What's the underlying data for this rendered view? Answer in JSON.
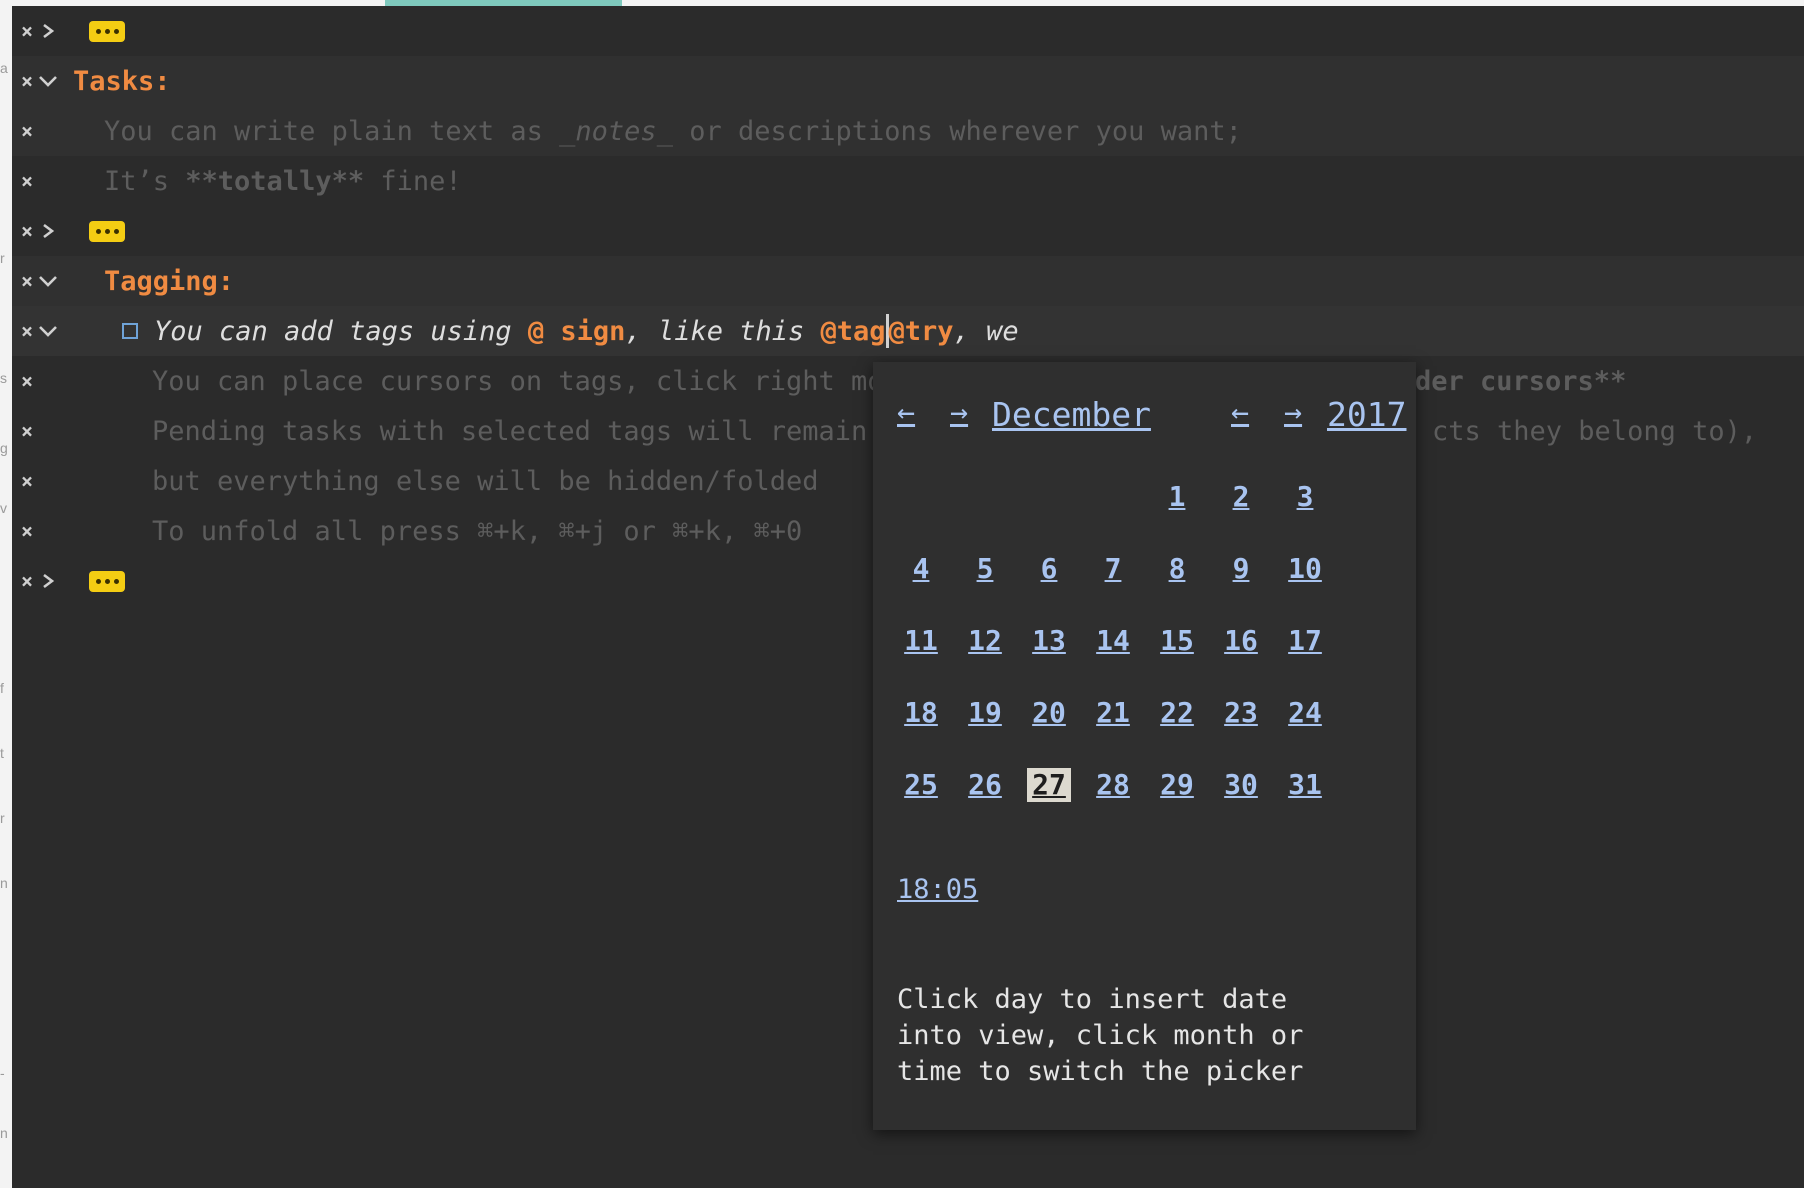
{
  "editor": {
    "folded_placeholder": "…",
    "tasks_project": "Tasks:",
    "notes": {
      "line1_a": "You can write plain text as ",
      "line1_b": "_notes_",
      "line1_c": " or descriptions wherever you want;",
      "line2_a": "It’s ",
      "line2_b": "**totally**",
      "line2_c": " fine!"
    },
    "tagging_project": "Tagging:",
    "task_line": {
      "a": "You can add tags using ",
      "tag_at": "@ sign",
      "b": ", like this ",
      "tag1": "@tag",
      "tag2": "@try",
      "c": ", we"
    },
    "sub_notes": {
      "line1_left": "You can place cursors on tags, click right mo",
      "line1_right": "der cursors**",
      "line2_left": "Pending tasks with selected tags will remain",
      "line2_right": "cts they belong to),",
      "line3": "but everything else will be hidden/folded",
      "line4": "To unfold all press ⌘+k, ⌘+j or ⌘+k, ⌘+0"
    }
  },
  "date_picker": {
    "month_prev": "←",
    "month_next": "→",
    "month": "December",
    "year_prev": "←",
    "year_next": "→",
    "year": "2017",
    "selected_day": "27",
    "days": [
      "1",
      "2",
      "3",
      "4",
      "5",
      "6",
      "7",
      "8",
      "9",
      "10",
      "11",
      "12",
      "13",
      "14",
      "15",
      "16",
      "17",
      "18",
      "19",
      "20",
      "21",
      "22",
      "23",
      "24",
      "25",
      "26",
      "27",
      "28",
      "29",
      "30",
      "31"
    ],
    "time": "18:05",
    "hint": "Click day to insert date\ninto view, click month or\ntime to switch the picker"
  },
  "colors": {
    "background": "#2b2b2b",
    "project": "#f08b42",
    "tag": "#f08b42",
    "picker_link": "#a9c4f0",
    "fold_badge": "#f4cd13"
  }
}
